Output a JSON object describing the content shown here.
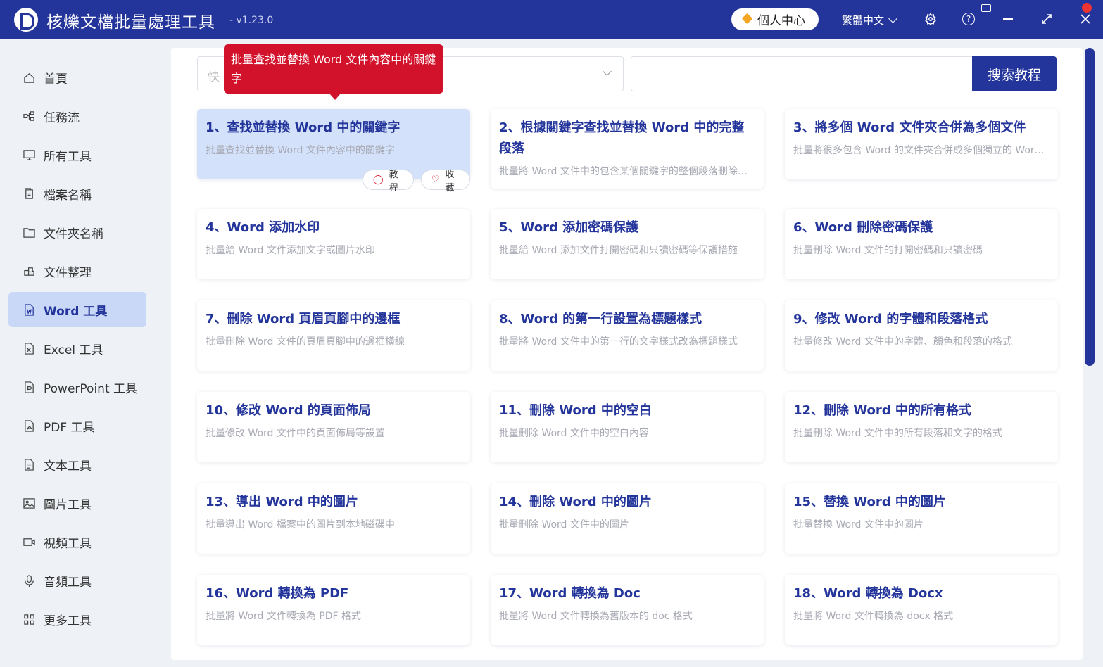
{
  "titlebar": {
    "title": "核爍文檔批量處理工具",
    "version": "- v1.23.0",
    "personal_center": "個人中心",
    "language": "繁體中文"
  },
  "sidebar": {
    "items": [
      {
        "label": "首頁",
        "icon": "home-icon"
      },
      {
        "label": "任務流",
        "icon": "workflow-icon"
      },
      {
        "label": "所有工具",
        "icon": "monitor-icon"
      },
      {
        "label": "檔案名稱",
        "icon": "file-copy-icon"
      },
      {
        "label": "文件夾名稱",
        "icon": "folder-icon"
      },
      {
        "label": "文件整理",
        "icon": "organize-icon"
      },
      {
        "label": "Word 工具",
        "icon": "word-icon",
        "active": true
      },
      {
        "label": "Excel 工具",
        "icon": "excel-icon"
      },
      {
        "label": "PowerPoint 工具",
        "icon": "ppt-icon"
      },
      {
        "label": "PDF 工具",
        "icon": "pdf-icon"
      },
      {
        "label": "文本工具",
        "icon": "text-icon"
      },
      {
        "label": "圖片工具",
        "icon": "image-icon"
      },
      {
        "label": "視頻工具",
        "icon": "video-icon"
      },
      {
        "label": "音頻工具",
        "icon": "mic-icon"
      },
      {
        "label": "更多工具",
        "icon": "grid-icon"
      }
    ]
  },
  "search": {
    "select_placeholder": "快",
    "input_value": "",
    "button": "搜索教程"
  },
  "tooltip": "批量查找並替換 Word 文件內容中的關鍵字",
  "card_actions": {
    "tutorial": "教程",
    "favorite": "收藏"
  },
  "cards": [
    {
      "title": "1、查找並替換 Word 中的關鍵字",
      "desc": "批量查找並替換 Word 文件內容中的關鍵字"
    },
    {
      "title": "2、根據關鍵字查找並替換 Word 中的完整段落",
      "desc": "批量將 Word 文件中的包含某個關鍵字的整個段落刪除或替換為其他內容"
    },
    {
      "title": "3、將多個 Word 文件夾合併為多個文件",
      "desc": "批量將很多包含 Word 的文件夾合併成多個獨立的 Word 文件"
    },
    {
      "title": "4、Word 添加水印",
      "desc": "批量給 Word 文件添加文字或圖片水印"
    },
    {
      "title": "5、Word 添加密碼保護",
      "desc": "批量給 Word 添加文件打開密碼和只讀密碼等保護措施"
    },
    {
      "title": "6、Word 刪除密碼保護",
      "desc": "批量刪除 Word 文件的打開密碼和只讀密碼"
    },
    {
      "title": "7、刪除 Word 頁眉頁腳中的邊框",
      "desc": "批量刪除 Word 文件的頁眉頁腳中的邊框橫線"
    },
    {
      "title": "8、Word 的第一行設置為標題樣式",
      "desc": "批量將 Word 文件中的第一行的文字樣式改為標題樣式"
    },
    {
      "title": "9、修改 Word 的字體和段落格式",
      "desc": "批量修改 Word 文件中的字體、顏色和段落的格式"
    },
    {
      "title": "10、修改 Word 的頁面佈局",
      "desc": "批量修改 Word 文件中的頁面佈局等設置"
    },
    {
      "title": "11、刪除 Word 中的空白",
      "desc": "批量刪除 Word 文件中的空白內容"
    },
    {
      "title": "12、刪除 Word 中的所有格式",
      "desc": "批量刪除 Word 文件中的所有段落和文字的格式"
    },
    {
      "title": "13、導出 Word 中的圖片",
      "desc": "批量導出 Word 檔案中的圖片到本地磁碟中"
    },
    {
      "title": "14、刪除 Word 中的圖片",
      "desc": "批量刪除 Word 文件中的圖片"
    },
    {
      "title": "15、替換 Word 中的圖片",
      "desc": "批量替換 Word 文件中的圖片"
    },
    {
      "title": "16、Word 轉換為 PDF",
      "desc": "批量將 Word 文件轉換為 PDF 格式"
    },
    {
      "title": "17、Word 轉換為 Doc",
      "desc": "批量將 Word 文件轉換為舊版本的 doc 格式"
    },
    {
      "title": "18、Word 轉換為 Docx",
      "desc": "批量將 Word 文件轉換為 docx 格式"
    }
  ]
}
